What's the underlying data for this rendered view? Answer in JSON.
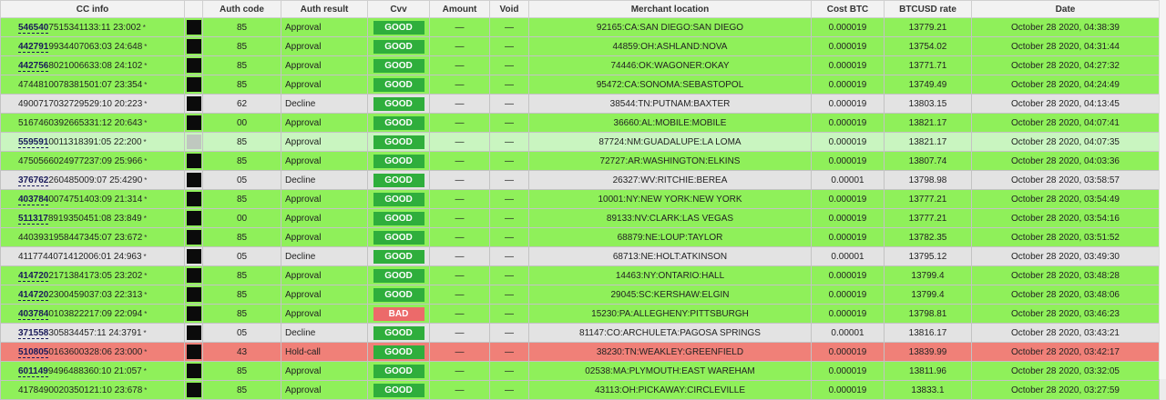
{
  "columns": [
    "CC info",
    "",
    "Auth code",
    "Auth result",
    "Cvv",
    "Amount",
    "Void",
    "Merchant location",
    "Cost BTC",
    "BTCUSD rate",
    "Date"
  ],
  "rows": [
    {
      "status": "green",
      "bin": "546540",
      "rest": "7515341133:11 23:002",
      "box": "dark",
      "auth_code": "85",
      "auth_result": "Approval",
      "cvv": "GOOD",
      "amount": "—",
      "void": "—",
      "location": "92165:CA:SAN DIEGO:SAN DIEGO",
      "cost_btc": "0.000019",
      "rate": "13779.21",
      "date": "October 28 2020, 04:38:39"
    },
    {
      "status": "green",
      "bin": "442791",
      "rest": "9934407063:03 24:648",
      "box": "dark",
      "auth_code": "85",
      "auth_result": "Approval",
      "cvv": "GOOD",
      "amount": "—",
      "void": "—",
      "location": "44859:OH:ASHLAND:NOVA",
      "cost_btc": "0.000019",
      "rate": "13754.02",
      "date": "October 28 2020, 04:31:44"
    },
    {
      "status": "green",
      "bin": "442756",
      "rest": "8021006633:08 24:102",
      "box": "dark",
      "auth_code": "85",
      "auth_result": "Approval",
      "cvv": "GOOD",
      "amount": "—",
      "void": "—",
      "location": "74446:OK:WAGONER:OKAY",
      "cost_btc": "0.000019",
      "rate": "13771.71",
      "date": "October 28 2020, 04:27:32"
    },
    {
      "status": "green",
      "bin": "",
      "rest": "4744810078381501:07 23:354",
      "box": "dark",
      "auth_code": "85",
      "auth_result": "Approval",
      "cvv": "GOOD",
      "amount": "—",
      "void": "—",
      "location": "95472:CA:SONOMA:SEBASTOPOL",
      "cost_btc": "0.000019",
      "rate": "13749.49",
      "date": "October 28 2020, 04:24:49"
    },
    {
      "status": "gray",
      "bin": "",
      "rest": "4900717032729529:10 20:223",
      "box": "dark",
      "auth_code": "62",
      "auth_result": "Decline",
      "cvv": "GOOD",
      "amount": "—",
      "void": "—",
      "location": "38544:TN:PUTNAM:BAXTER",
      "cost_btc": "0.000019",
      "rate": "13803.15",
      "date": "October 28 2020, 04:13:45"
    },
    {
      "status": "green",
      "bin": "",
      "rest": "5167460392665331:12 20:643",
      "box": "dark",
      "auth_code": "00",
      "auth_result": "Approval",
      "cvv": "GOOD",
      "amount": "—",
      "void": "—",
      "location": "36660:AL:MOBILE:MOBILE",
      "cost_btc": "0.000019",
      "rate": "13821.17",
      "date": "October 28 2020, 04:07:41"
    },
    {
      "status": "pale",
      "bin": "559591",
      "rest": "0011318391:05 22:200",
      "box": "light",
      "auth_code": "85",
      "auth_result": "Approval",
      "cvv": "GOOD",
      "amount": "—",
      "void": "—",
      "location": "87724:NM:GUADALUPE:LA LOMA",
      "cost_btc": "0.000019",
      "rate": "13821.17",
      "date": "October 28 2020, 04:07:35"
    },
    {
      "status": "green",
      "bin": "",
      "rest": "4750566024977237:09 25:966",
      "box": "dark",
      "auth_code": "85",
      "auth_result": "Approval",
      "cvv": "GOOD",
      "amount": "—",
      "void": "—",
      "location": "72727:AR:WASHINGTON:ELKINS",
      "cost_btc": "0.000019",
      "rate": "13807.74",
      "date": "October 28 2020, 04:03:36"
    },
    {
      "status": "gray",
      "bin": "376762",
      "rest": "260485009:07 25:4290",
      "box": "dark",
      "auth_code": "05",
      "auth_result": "Decline",
      "cvv": "GOOD",
      "amount": "—",
      "void": "—",
      "location": "26327:WV:RITCHIE:BEREA",
      "cost_btc": "0.00001",
      "rate": "13798.98",
      "date": "October 28 2020, 03:58:57"
    },
    {
      "status": "green",
      "bin": "403784",
      "rest": "0074751403:09 21:314",
      "box": "dark",
      "auth_code": "85",
      "auth_result": "Approval",
      "cvv": "GOOD",
      "amount": "—",
      "void": "—",
      "location": "10001:NY:NEW YORK:NEW YORK",
      "cost_btc": "0.000019",
      "rate": "13777.21",
      "date": "October 28 2020, 03:54:49"
    },
    {
      "status": "green",
      "bin": "511317",
      "rest": "8919350451:08 23:849",
      "box": "dark",
      "auth_code": "00",
      "auth_result": "Approval",
      "cvv": "GOOD",
      "amount": "—",
      "void": "—",
      "location": "89133:NV:CLARK:LAS VEGAS",
      "cost_btc": "0.000019",
      "rate": "13777.21",
      "date": "October 28 2020, 03:54:16"
    },
    {
      "status": "green",
      "bin": "",
      "rest": "4403931958447345:07 23:672",
      "box": "dark",
      "auth_code": "85",
      "auth_result": "Approval",
      "cvv": "GOOD",
      "amount": "—",
      "void": "—",
      "location": "68879:NE:LOUP:TAYLOR",
      "cost_btc": "0.000019",
      "rate": "13782.35",
      "date": "October 28 2020, 03:51:52"
    },
    {
      "status": "gray",
      "bin": "",
      "rest": "4117744071412006:01 24:963",
      "box": "dark",
      "auth_code": "05",
      "auth_result": "Decline",
      "cvv": "GOOD",
      "amount": "—",
      "void": "—",
      "location": "68713:NE:HOLT:ATKINSON",
      "cost_btc": "0.00001",
      "rate": "13795.12",
      "date": "October 28 2020, 03:49:30"
    },
    {
      "status": "green",
      "bin": "414720",
      "rest": "2171384173:05 23:202",
      "box": "dark",
      "auth_code": "85",
      "auth_result": "Approval",
      "cvv": "GOOD",
      "amount": "—",
      "void": "—",
      "location": "14463:NY:ONTARIO:HALL",
      "cost_btc": "0.000019",
      "rate": "13799.4",
      "date": "October 28 2020, 03:48:28"
    },
    {
      "status": "green",
      "bin": "414720",
      "rest": "2300459037:03 22:313",
      "box": "dark",
      "auth_code": "85",
      "auth_result": "Approval",
      "cvv": "GOOD",
      "amount": "—",
      "void": "—",
      "location": "29045:SC:KERSHAW:ELGIN",
      "cost_btc": "0.000019",
      "rate": "13799.4",
      "date": "October 28 2020, 03:48:06"
    },
    {
      "status": "green",
      "bin": "403784",
      "rest": "0103822217:09 22:094",
      "box": "dark",
      "auth_code": "85",
      "auth_result": "Approval",
      "cvv": "BAD",
      "amount": "—",
      "void": "—",
      "location": "15230:PA:ALLEGHENY:PITTSBURGH",
      "cost_btc": "0.000019",
      "rate": "13798.81",
      "date": "October 28 2020, 03:46:23"
    },
    {
      "status": "gray",
      "bin": "371558",
      "rest": "305834457:11 24:3791",
      "box": "dark",
      "auth_code": "05",
      "auth_result": "Decline",
      "cvv": "GOOD",
      "amount": "—",
      "void": "—",
      "location": "81147:CO:ARCHULETA:PAGOSA SPRINGS",
      "cost_btc": "0.00001",
      "rate": "13816.17",
      "date": "October 28 2020, 03:43:21"
    },
    {
      "status": "red",
      "bin": "510805",
      "rest": "0163600328:06 23:000",
      "box": "dark",
      "auth_code": "43",
      "auth_result": "Hold-call",
      "cvv": "GOOD",
      "amount": "—",
      "void": "—",
      "location": "38230:TN:WEAKLEY:GREENFIELD",
      "cost_btc": "0.000019",
      "rate": "13839.99",
      "date": "October 28 2020, 03:42:17"
    },
    {
      "status": "green",
      "bin": "601149",
      "rest": "9496488360:10 21:057",
      "box": "dark",
      "auth_code": "85",
      "auth_result": "Approval",
      "cvv": "GOOD",
      "amount": "—",
      "void": "—",
      "location": "02538:MA:PLYMOUTH:EAST WAREHAM",
      "cost_btc": "0.000019",
      "rate": "13811.96",
      "date": "October 28 2020, 03:32:05"
    },
    {
      "status": "green",
      "bin": "",
      "rest": "4178490020350121:10 23:678",
      "box": "dark",
      "auth_code": "85",
      "auth_result": "Approval",
      "cvv": "GOOD",
      "amount": "—",
      "void": "—",
      "location": "43113:OH:PICKAWAY:CIRCLEVILLE",
      "cost_btc": "0.000019",
      "rate": "13833.1",
      "date": "October 28 2020, 03:27:59"
    }
  ],
  "colors": {
    "approval_row": "#8ff05a",
    "decline_row": "#e3e3e3",
    "hold_row": "#f08078",
    "cvv_good": "#2fae3c",
    "cvv_bad": "#ec6a6a"
  }
}
